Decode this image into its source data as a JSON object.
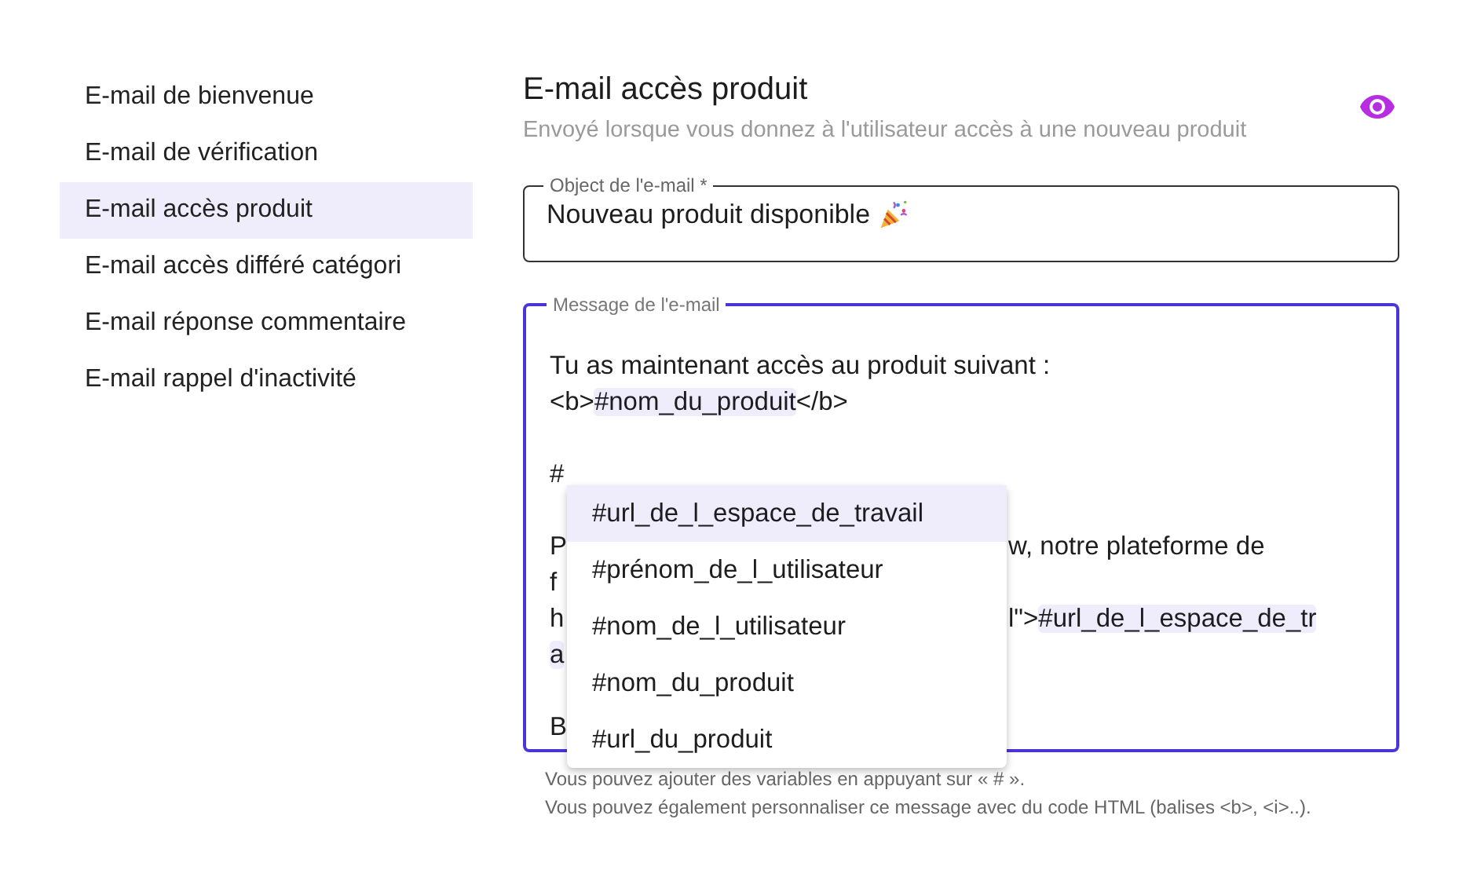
{
  "sidebar": {
    "items": [
      {
        "label": "E-mail de bienvenue",
        "selected": false
      },
      {
        "label": "E-mail de vérification",
        "selected": false
      },
      {
        "label": "E-mail accès produit",
        "selected": true
      },
      {
        "label": "E-mail accès différé catégori",
        "selected": false
      },
      {
        "label": "E-mail réponse commentaire",
        "selected": false
      },
      {
        "label": "E-mail rappel d'inactivité",
        "selected": false
      }
    ]
  },
  "header": {
    "title": "E-mail accès produit",
    "subtitle": "Envoyé lorsque vous donnez à l'utilisateur accès à une nouveau produit"
  },
  "subject_field": {
    "label": "Object de l'e-mail *",
    "value": "Nouveau produit disponible"
  },
  "message_field": {
    "label": "Message de l'e-mail",
    "focused": true,
    "lines": [
      {
        "kind": "text",
        "left": [
          {
            "text": "Tu as maintenant accès au produit suivant :"
          }
        ]
      },
      {
        "kind": "text",
        "left": [
          {
            "text": "<b>"
          },
          {
            "text": "#nom_du_produit",
            "kind": "variable"
          },
          {
            "text": "</b>"
          }
        ]
      },
      {
        "kind": "blank"
      },
      {
        "kind": "text",
        "left": [
          {
            "text": "#"
          }
        ]
      },
      {
        "kind": "blank"
      },
      {
        "kind": "text",
        "left": [
          {
            "text": "P"
          }
        ],
        "right": [
          {
            "text": "w, notre plateforme de"
          }
        ]
      },
      {
        "kind": "text",
        "left": [
          {
            "text": "f"
          }
        ]
      },
      {
        "kind": "text",
        "left": [
          {
            "text": "h"
          }
        ],
        "right": [
          {
            "text": "l\">"
          },
          {
            "text": "#url_de_l_espace_de_tr",
            "kind": "variable"
          }
        ]
      },
      {
        "kind": "text",
        "left": [
          {
            "text": "a",
            "kind": "variable"
          }
        ]
      },
      {
        "kind": "blank"
      },
      {
        "kind": "text",
        "left": [
          {
            "text": "B"
          }
        ]
      }
    ],
    "autocomplete": {
      "items": [
        {
          "label": "#url_de_l_espace_de_travail",
          "selected": true
        },
        {
          "label": "#prénom_de_l_utilisateur",
          "selected": false
        },
        {
          "label": "#nom_de_l_utilisateur",
          "selected": false
        },
        {
          "label": "#nom_du_produit",
          "selected": false
        },
        {
          "label": "#url_du_produit",
          "selected": false
        }
      ]
    }
  },
  "helper_texts": [
    "Vous pouvez ajouter des variables en appuyant sur « # ».",
    "Vous pouvez également personnaliser ce message avec du code HTML (balises <b>, <i>..)."
  ]
}
